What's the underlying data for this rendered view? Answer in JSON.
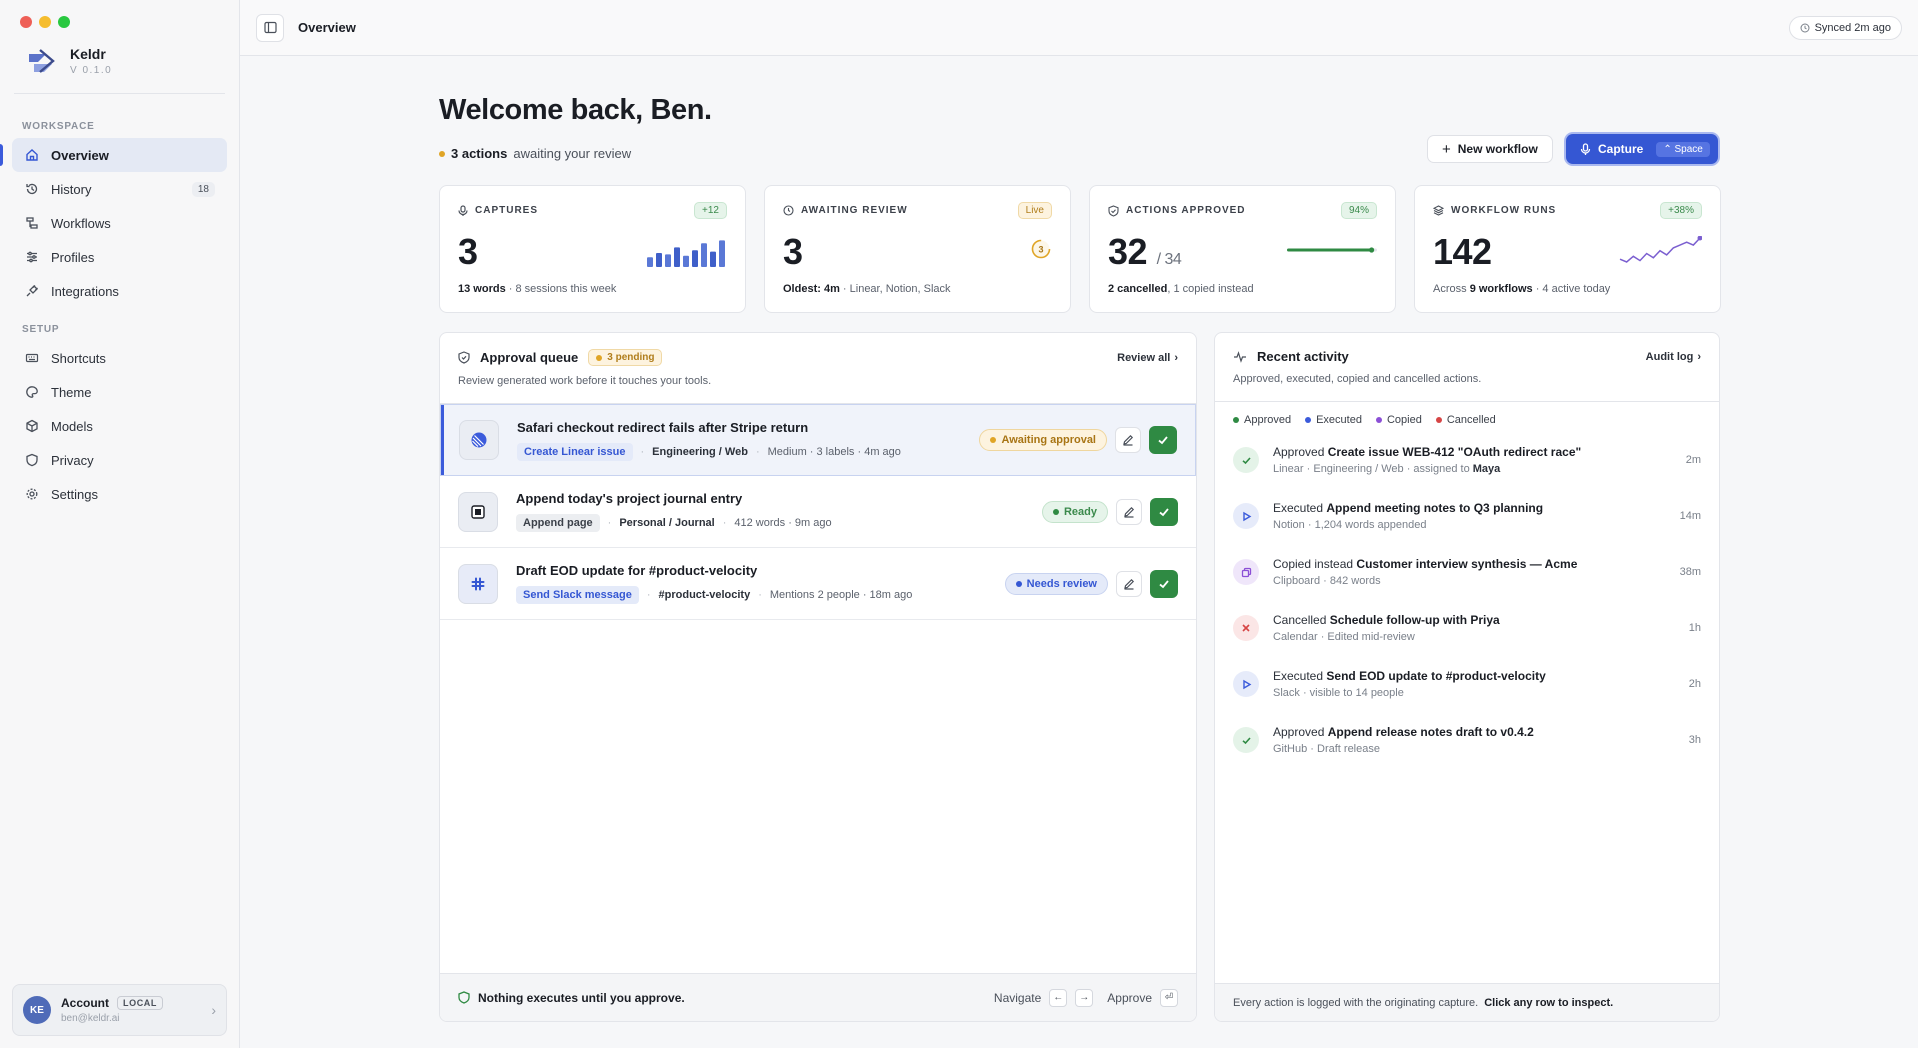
{
  "colors": {
    "accent": "#3557d3",
    "approved": "#2f8a43",
    "executed": "#3b5bdb",
    "copied": "#8b4fd6",
    "cancelled": "#d64545",
    "amber": "#e0a526"
  },
  "app": {
    "name": "Keldr",
    "version": "V 0.1.0"
  },
  "sidebar": {
    "workspace_label": "WORKSPACE",
    "setup_label": "SETUP",
    "workspace_items": [
      {
        "label": "Overview",
        "icon": "home-icon"
      },
      {
        "label": "History",
        "icon": "history-icon",
        "badge": "18"
      },
      {
        "label": "Workflows",
        "icon": "workflow-icon"
      },
      {
        "label": "Profiles",
        "icon": "sliders-icon"
      },
      {
        "label": "Integrations",
        "icon": "plug-icon"
      }
    ],
    "setup_items": [
      {
        "label": "Shortcuts",
        "icon": "keyboard-icon"
      },
      {
        "label": "Theme",
        "icon": "palette-icon"
      },
      {
        "label": "Models",
        "icon": "cube-icon"
      },
      {
        "label": "Privacy",
        "icon": "shield-icon"
      },
      {
        "label": "Settings",
        "icon": "gear-icon"
      }
    ],
    "account": {
      "initials": "KE",
      "name": "Account",
      "badge": "LOCAL",
      "email": "ben@keldr.ai"
    }
  },
  "topbar": {
    "title": "Overview",
    "synced": "Synced 2m ago"
  },
  "header": {
    "welcome": "Welcome back, Ben.",
    "actions_count": "3 actions",
    "actions_suffix": "awaiting your review",
    "new_workflow": "New workflow",
    "capture": "Capture",
    "capture_key": "⌃ Space"
  },
  "stats": [
    {
      "label": "CAPTURES",
      "pill": "+12",
      "value": "3",
      "foot_b": "13 words",
      "foot": " · 8 sessions this week",
      "bars": [
        0.35,
        0.5,
        0.45,
        0.7,
        0.4,
        0.6,
        0.85,
        0.55,
        0.95
      ]
    },
    {
      "label": "AWAITING REVIEW",
      "pill": "Live",
      "value": "3",
      "foot_b": "Oldest: 4m",
      "foot": " · Linear, Notion, Slack",
      "ring": "3"
    },
    {
      "label": "ACTIONS APPROVED",
      "pill": "94%",
      "value": "32",
      "value_suffix": "/ 34",
      "foot_b": "2 cancelled",
      "foot": ", 1 copied instead",
      "progress": 0.94
    },
    {
      "label": "WORKFLOW RUNS",
      "pill": "+38%",
      "value": "142",
      "foot_pre": "Across ",
      "foot_b": "9 workflows",
      "foot": " · 4 active today",
      "spark": [
        12,
        10,
        14,
        11,
        16,
        13,
        18,
        15,
        20,
        22,
        24,
        22,
        27
      ]
    }
  ],
  "queue": {
    "title": "Approval queue",
    "pending": "3 pending",
    "review_all": "Review all",
    "subtitle": "Review generated work before it touches your tools.",
    "items": [
      {
        "title": "Safari checkout redirect fails after Stripe return",
        "tag": "Create Linear issue",
        "tag_style": "blue",
        "path": "Engineering / Web",
        "meta": "Medium · 3 labels · 4m ago",
        "status": "Awaiting approval",
        "status_style": "amber",
        "icon": "linear-icon"
      },
      {
        "title": "Append today's project journal entry",
        "tag": "Append page",
        "tag_style": "gray",
        "path": "Personal / Journal",
        "meta": "412 words · 9m ago",
        "status": "Ready",
        "status_style": "green",
        "icon": "notion-icon"
      },
      {
        "title": "Draft EOD update for #product-velocity",
        "tag": "Send Slack message",
        "tag_style": "blue",
        "path": "#product-velocity",
        "meta": "Mentions 2 people · 18m ago",
        "status": "Needs review",
        "status_style": "blue",
        "icon": "slack-icon"
      }
    ],
    "footer_msg": "Nothing executes until you approve.",
    "navigate": "Navigate",
    "approve": "Approve"
  },
  "activity": {
    "title": "Recent activity",
    "audit_log": "Audit log",
    "subtitle": "Approved, executed, copied and cancelled actions.",
    "legend": [
      "Approved",
      "Executed",
      "Copied",
      "Cancelled"
    ],
    "items": [
      {
        "kind": "approved",
        "verb": "Approved",
        "title": "Create issue WEB-412 \"OAuth redirect race\"",
        "sub": "Linear · Engineering / Web · assigned to ",
        "sub_b": "Maya",
        "time": "2m"
      },
      {
        "kind": "executed",
        "verb": "Executed",
        "title": "Append meeting notes to Q3 planning",
        "sub": "Notion · 1,204 words appended",
        "sub_b": "",
        "time": "14m"
      },
      {
        "kind": "copied",
        "verb": "Copied instead",
        "title": "Customer interview synthesis — Acme",
        "sub": "Clipboard · 842 words",
        "sub_b": "",
        "time": "38m"
      },
      {
        "kind": "cancelled",
        "verb": "Cancelled",
        "title": "Schedule follow-up with Priya",
        "sub": "Calendar · Edited mid-review",
        "sub_b": "",
        "time": "1h"
      },
      {
        "kind": "executed",
        "verb": "Executed",
        "title": "Send EOD update to #product-velocity",
        "sub": "Slack · visible to 14 people",
        "sub_b": "",
        "time": "2h"
      },
      {
        "kind": "approved",
        "verb": "Approved",
        "title": "Append release notes draft to v0.4.2",
        "sub": "GitHub · Draft release",
        "sub_b": "",
        "time": "3h"
      }
    ],
    "footer": "Every action is logged with the originating capture.",
    "footer_b": "Click any row to inspect."
  }
}
